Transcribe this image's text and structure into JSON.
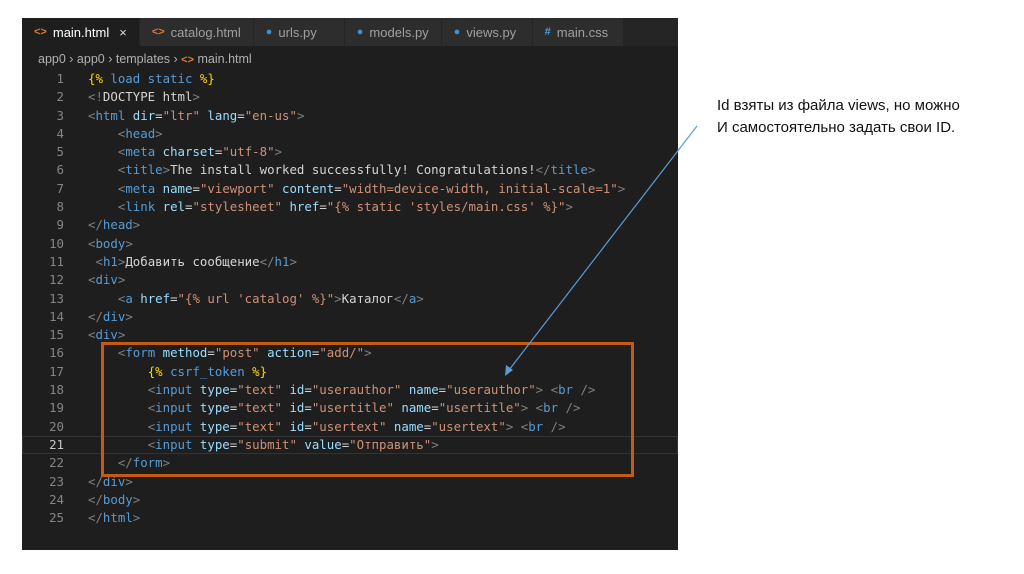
{
  "tabs": [
    {
      "label": "main.html",
      "icon": "html-icon",
      "glyph": "<>",
      "kind": "html",
      "active": true,
      "close": "×"
    },
    {
      "label": "catalog.html",
      "icon": "html-icon",
      "glyph": "<>",
      "kind": "html"
    },
    {
      "label": "urls.py",
      "icon": "python-icon",
      "glyph": "●",
      "kind": "py"
    },
    {
      "label": "models.py",
      "icon": "python-icon",
      "glyph": "●",
      "kind": "py"
    },
    {
      "label": "views.py",
      "icon": "python-icon",
      "glyph": "●",
      "kind": "py"
    },
    {
      "label": "main.css",
      "icon": "css-icon",
      "glyph": "#",
      "kind": "css"
    }
  ],
  "breadcrumb": {
    "items": [
      "app0",
      "app0",
      "templates"
    ],
    "file": "main.html",
    "sep": " › ",
    "glyph": "<>"
  },
  "current_line": 21,
  "code": [
    [
      [
        "k",
        "{%"
      ],
      [
        "kw",
        " load static "
      ],
      [
        "k",
        "%}"
      ]
    ],
    [
      [
        "p",
        "<!"
      ],
      [
        "x",
        "DOCTYPE "
      ],
      [
        "e",
        "html"
      ],
      [
        "p",
        ">"
      ]
    ],
    [
      [
        "p",
        "<"
      ],
      [
        "t",
        "html "
      ],
      [
        "a",
        "dir"
      ],
      [
        "x",
        "="
      ],
      [
        "s",
        "\"ltr\" "
      ],
      [
        "a",
        "lang"
      ],
      [
        "x",
        "="
      ],
      [
        "s",
        "\"en-us\""
      ],
      [
        "p",
        ">"
      ]
    ],
    [
      [
        "x",
        "    "
      ],
      [
        "p",
        "<"
      ],
      [
        "t",
        "head"
      ],
      [
        "p",
        ">"
      ]
    ],
    [
      [
        "x",
        "    "
      ],
      [
        "p",
        "<"
      ],
      [
        "t",
        "meta "
      ],
      [
        "a",
        "charset"
      ],
      [
        "x",
        "="
      ],
      [
        "s",
        "\"utf-8\""
      ],
      [
        "p",
        ">"
      ]
    ],
    [
      [
        "x",
        "    "
      ],
      [
        "p",
        "<"
      ],
      [
        "t",
        "title"
      ],
      [
        "p",
        ">"
      ],
      [
        "x",
        "The install worked successfully! Congratulations!"
      ],
      [
        "p",
        "</"
      ],
      [
        "t",
        "title"
      ],
      [
        "p",
        ">"
      ]
    ],
    [
      [
        "x",
        "    "
      ],
      [
        "p",
        "<"
      ],
      [
        "t",
        "meta "
      ],
      [
        "a",
        "name"
      ],
      [
        "x",
        "="
      ],
      [
        "s",
        "\"viewport\" "
      ],
      [
        "a",
        "content"
      ],
      [
        "x",
        "="
      ],
      [
        "s",
        "\"width=device-width, initial-scale=1\""
      ],
      [
        "p",
        ">"
      ]
    ],
    [
      [
        "x",
        "    "
      ],
      [
        "p",
        "<"
      ],
      [
        "t",
        "link "
      ],
      [
        "a",
        "rel"
      ],
      [
        "x",
        "="
      ],
      [
        "s",
        "\"stylesheet\" "
      ],
      [
        "a",
        "href"
      ],
      [
        "x",
        "="
      ],
      [
        "s",
        "\"{% static 'styles/main.css' %}\""
      ],
      [
        "p",
        ">"
      ]
    ],
    [
      [
        "p",
        "</"
      ],
      [
        "t",
        "head"
      ],
      [
        "p",
        ">"
      ]
    ],
    [
      [
        "p",
        "<"
      ],
      [
        "t",
        "body"
      ],
      [
        "p",
        ">"
      ]
    ],
    [
      [
        "x",
        " "
      ],
      [
        "p",
        "<"
      ],
      [
        "t",
        "h1"
      ],
      [
        "p",
        ">"
      ],
      [
        "x",
        "Добавить сообщение"
      ],
      [
        "p",
        "</"
      ],
      [
        "t",
        "h1"
      ],
      [
        "p",
        ">"
      ]
    ],
    [
      [
        "p",
        "<"
      ],
      [
        "t",
        "div"
      ],
      [
        "p",
        ">"
      ]
    ],
    [
      [
        "x",
        "    "
      ],
      [
        "p",
        "<"
      ],
      [
        "t",
        "a "
      ],
      [
        "a",
        "href"
      ],
      [
        "x",
        "="
      ],
      [
        "s",
        "\"{% url 'catalog' %}\""
      ],
      [
        "p",
        ">"
      ],
      [
        "x",
        "Каталог"
      ],
      [
        "p",
        "</"
      ],
      [
        "t",
        "a"
      ],
      [
        "p",
        ">"
      ]
    ],
    [
      [
        "p",
        "</"
      ],
      [
        "t",
        "div"
      ],
      [
        "p",
        ">"
      ]
    ],
    [
      [
        "p",
        "<"
      ],
      [
        "t",
        "div"
      ],
      [
        "p",
        ">"
      ]
    ],
    [
      [
        "x",
        "    "
      ],
      [
        "p",
        "<"
      ],
      [
        "t",
        "form "
      ],
      [
        "a",
        "method"
      ],
      [
        "x",
        "="
      ],
      [
        "s",
        "\"post\" "
      ],
      [
        "a",
        "action"
      ],
      [
        "x",
        "="
      ],
      [
        "s",
        "\"add/\""
      ],
      [
        "p",
        ">"
      ]
    ],
    [
      [
        "x",
        "        "
      ],
      [
        "k",
        "{%"
      ],
      [
        "kw",
        " csrf_token "
      ],
      [
        "k",
        "%}"
      ]
    ],
    [
      [
        "x",
        "        "
      ],
      [
        "p",
        "<"
      ],
      [
        "t",
        "input "
      ],
      [
        "a",
        "type"
      ],
      [
        "x",
        "="
      ],
      [
        "s",
        "\"text\" "
      ],
      [
        "a",
        "id"
      ],
      [
        "x",
        "="
      ],
      [
        "s",
        "\"userauthor\" "
      ],
      [
        "a",
        "name"
      ],
      [
        "x",
        "="
      ],
      [
        "s",
        "\"userauthor\""
      ],
      [
        "p",
        "> <"
      ],
      [
        "t",
        "br "
      ],
      [
        "p",
        "/>"
      ]
    ],
    [
      [
        "x",
        "        "
      ],
      [
        "p",
        "<"
      ],
      [
        "t",
        "input "
      ],
      [
        "a",
        "type"
      ],
      [
        "x",
        "="
      ],
      [
        "s",
        "\"text\" "
      ],
      [
        "a",
        "id"
      ],
      [
        "x",
        "="
      ],
      [
        "s",
        "\"usertitle\" "
      ],
      [
        "a",
        "name"
      ],
      [
        "x",
        "="
      ],
      [
        "s",
        "\"usertitle\""
      ],
      [
        "p",
        "> <"
      ],
      [
        "t",
        "br "
      ],
      [
        "p",
        "/>"
      ]
    ],
    [
      [
        "x",
        "        "
      ],
      [
        "p",
        "<"
      ],
      [
        "t",
        "input "
      ],
      [
        "a",
        "type"
      ],
      [
        "x",
        "="
      ],
      [
        "s",
        "\"text\" "
      ],
      [
        "a",
        "id"
      ],
      [
        "x",
        "="
      ],
      [
        "s",
        "\"usertext\" "
      ],
      [
        "a",
        "name"
      ],
      [
        "x",
        "="
      ],
      [
        "s",
        "\"usertext\""
      ],
      [
        "p",
        "> <"
      ],
      [
        "t",
        "br "
      ],
      [
        "p",
        "/>"
      ]
    ],
    [
      [
        "x",
        "        "
      ],
      [
        "p",
        "<"
      ],
      [
        "t",
        "input "
      ],
      [
        "a",
        "type"
      ],
      [
        "x",
        "="
      ],
      [
        "s",
        "\"submit\" "
      ],
      [
        "a",
        "value"
      ],
      [
        "x",
        "="
      ],
      [
        "s",
        "\"Отправить\""
      ],
      [
        "p",
        ">"
      ]
    ],
    [
      [
        "x",
        "    "
      ],
      [
        "p",
        "</"
      ],
      [
        "t",
        "form"
      ],
      [
        "p",
        ">"
      ]
    ],
    [
      [
        "p",
        "</"
      ],
      [
        "t",
        "div"
      ],
      [
        "p",
        ">"
      ]
    ],
    [
      [
        "p",
        "</"
      ],
      [
        "t",
        "body"
      ],
      [
        "p",
        ">"
      ]
    ],
    [
      [
        "p",
        "</"
      ],
      [
        "t",
        "html"
      ],
      [
        "p",
        ">"
      ]
    ]
  ],
  "annotation": {
    "line1": "Id взяты из файла views, но можно",
    "line2": "И самостоятельно задать свои ID."
  },
  "colors": {
    "highlight_box": "#c55a11",
    "arrow": "#5b9bd5"
  }
}
